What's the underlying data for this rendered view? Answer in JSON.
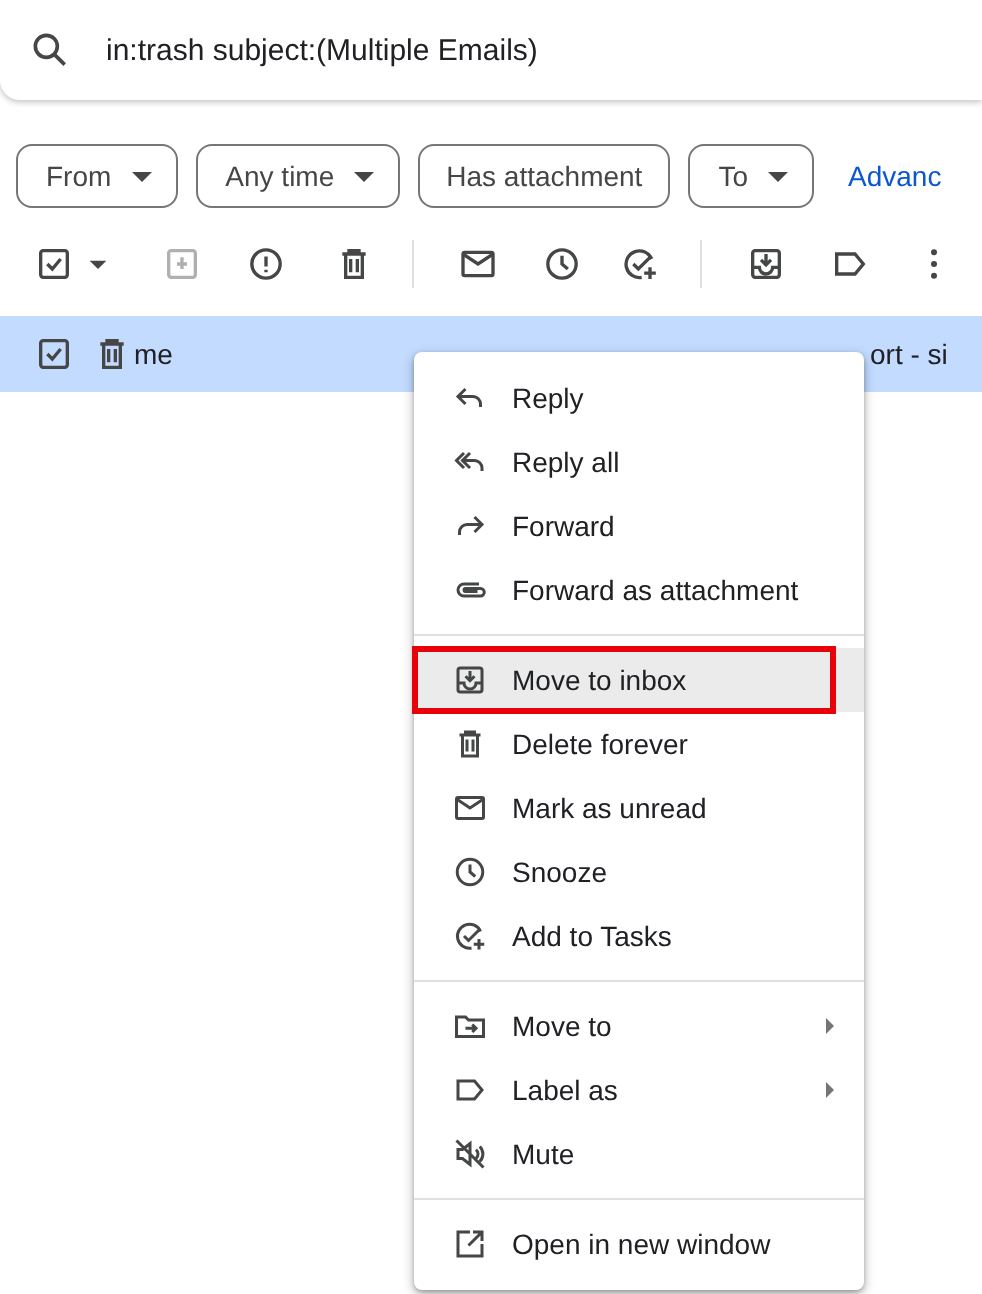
{
  "search": {
    "query": "in:trash subject:(Multiple Emails)"
  },
  "filters": [
    {
      "label": "From",
      "kind": "dropdown"
    },
    {
      "label": "Any time",
      "kind": "dropdown"
    },
    {
      "label": "Has attachment",
      "kind": "toggle"
    },
    {
      "label": "To",
      "kind": "dropdown"
    }
  ],
  "advanced_link": "Advanc",
  "email": {
    "selected": true,
    "checked": true,
    "sender": "me",
    "subject": "ort - si"
  },
  "menu": {
    "sections": [
      {
        "items": [
          {
            "label": "Reply",
            "submenu": false,
            "selected": false
          },
          {
            "label": "Reply all",
            "submenu": false,
            "selected": false
          },
          {
            "label": "Forward",
            "submenu": false,
            "selected": false
          },
          {
            "label": "Forward as attachment",
            "submenu": false,
            "selected": false
          }
        ]
      },
      {
        "items": [
          {
            "label": "Move to inbox",
            "submenu": false,
            "selected": true
          },
          {
            "label": "Delete forever",
            "submenu": false,
            "selected": false
          },
          {
            "label": "Mark as unread",
            "submenu": false,
            "selected": false
          },
          {
            "label": "Snooze",
            "submenu": false,
            "selected": false
          },
          {
            "label": "Add to Tasks",
            "submenu": false,
            "selected": false
          }
        ]
      },
      {
        "items": [
          {
            "label": "Move to",
            "submenu": true,
            "selected": false
          },
          {
            "label": "Label as",
            "submenu": true,
            "selected": false
          },
          {
            "label": "Mute",
            "submenu": false,
            "selected": false
          }
        ]
      },
      {
        "items": [
          {
            "label": "Open in new window",
            "submenu": false,
            "selected": false
          }
        ]
      }
    ]
  }
}
